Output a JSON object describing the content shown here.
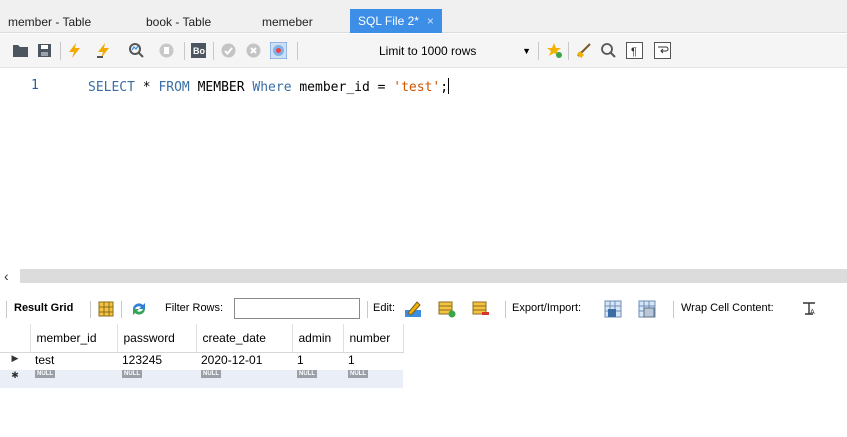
{
  "tabs": [
    {
      "label": "member - Table"
    },
    {
      "label": "book - Table"
    },
    {
      "label": "memeber"
    },
    {
      "label": "SQL File 2*",
      "close": "×"
    }
  ],
  "toolbar": {
    "limit_label": "Limit to 1000 rows",
    "icons": [
      "open-folder-icon",
      "save-icon",
      "execute-lightning-icon",
      "execute-cursor-lightning-icon",
      "explain-magnifier-icon",
      "stop-icon",
      "toggle-autocommit-icon",
      "commit-icon",
      "rollback-icon",
      "toggle-error-icon",
      "add-snippet-icon",
      "beautify-icon",
      "find-icon",
      "invisible-chars-icon",
      "wrap-icon"
    ]
  },
  "editor": {
    "line_number": "1",
    "sql": {
      "p1": "SELECT",
      "p2": " * ",
      "p3": "FROM",
      "p4": " MEMBER ",
      "p5": "Where",
      "p6": " member_id = ",
      "p7": "'test'",
      "p8": ";"
    }
  },
  "results": {
    "grid_label": "Result Grid",
    "filter_label": "Filter Rows:",
    "filter_value": "",
    "edit_label": "Edit:",
    "export_label": "Export/Import:",
    "wrap_label": "Wrap Cell Content:",
    "columns": [
      "member_id",
      "password",
      "create_date",
      "admin",
      "number"
    ],
    "rows": [
      {
        "marker": "▶",
        "cells": [
          "test",
          "123245",
          "2020-12-01",
          "1",
          "1"
        ]
      }
    ],
    "new_row": {
      "marker": "✱",
      "null_label": "NULL"
    }
  },
  "colors": {
    "active_tab": "#3c8ee6",
    "keyword": "#3a6ea5",
    "string": "#cc5500"
  }
}
